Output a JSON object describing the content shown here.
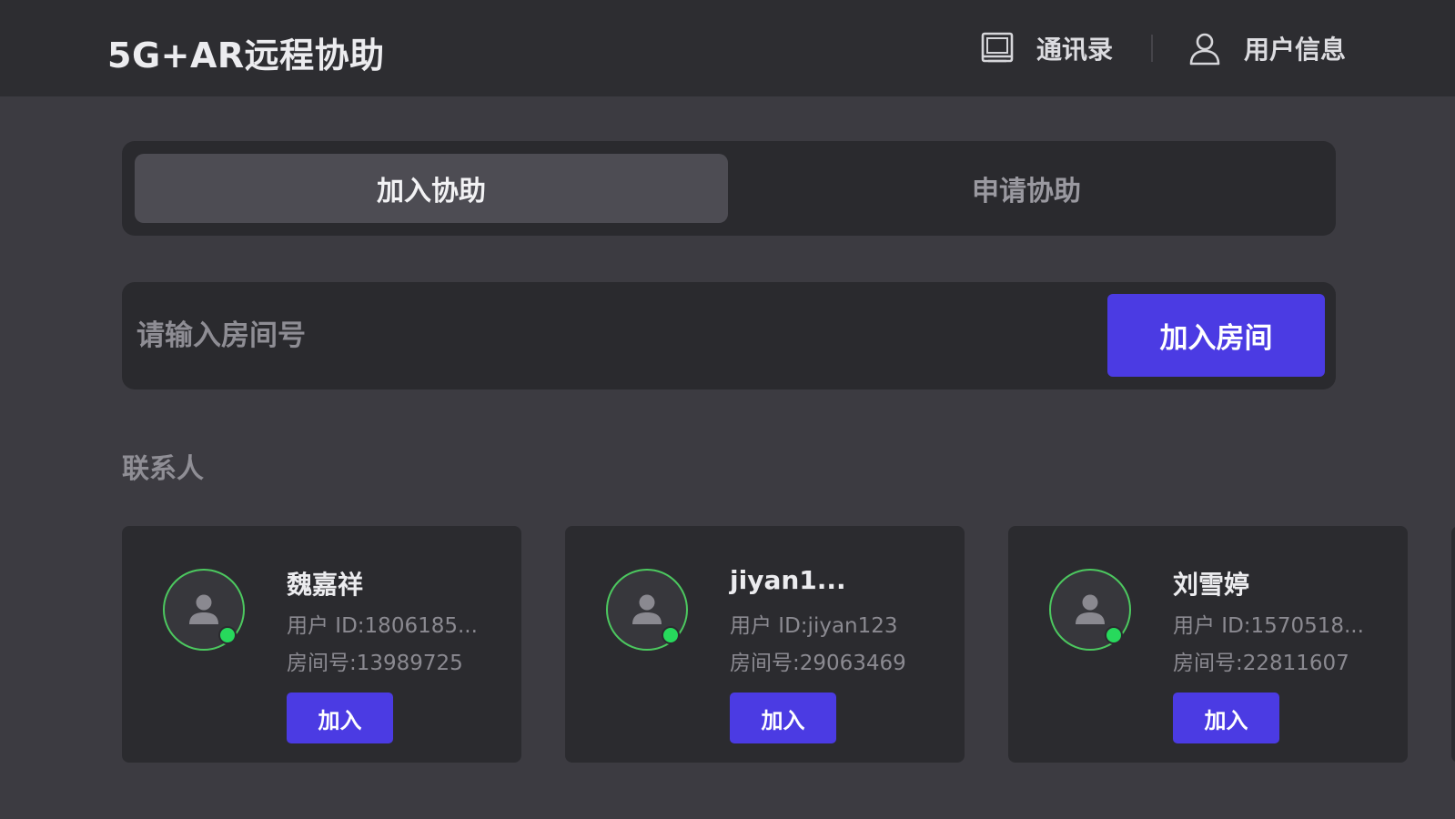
{
  "header": {
    "title": "5G+AR远程协助",
    "nav": {
      "contacts_label": "通讯录",
      "contacts_icon": "address-book-icon",
      "user_label": "用户信息",
      "user_icon": "user-icon"
    }
  },
  "tabs": [
    {
      "label": "加入协助",
      "active": true
    },
    {
      "label": "申请协助",
      "active": false
    }
  ],
  "room": {
    "placeholder": "请输入房间号",
    "value": "",
    "button_label": "加入房间"
  },
  "contacts": {
    "section_label": "联系人",
    "items": [
      {
        "name": "魏嘉祥",
        "user_id": "用户 ID:1806185...",
        "room": "房间号:13989725",
        "join_label": "加入",
        "online": true
      },
      {
        "name": "jiyan1...",
        "user_id": "用户 ID:jiyan123",
        "room": "房间号:29063469",
        "join_label": "加入",
        "online": true
      },
      {
        "name": "刘雪婷",
        "user_id": "用户 ID:1570518...",
        "room": "房间号:22811607",
        "join_label": "加入",
        "online": true
      }
    ]
  },
  "colors": {
    "accent": "#4b3be3",
    "online": "#27d95c",
    "background": "#3c3b41",
    "panel": "#2a2a2e"
  }
}
